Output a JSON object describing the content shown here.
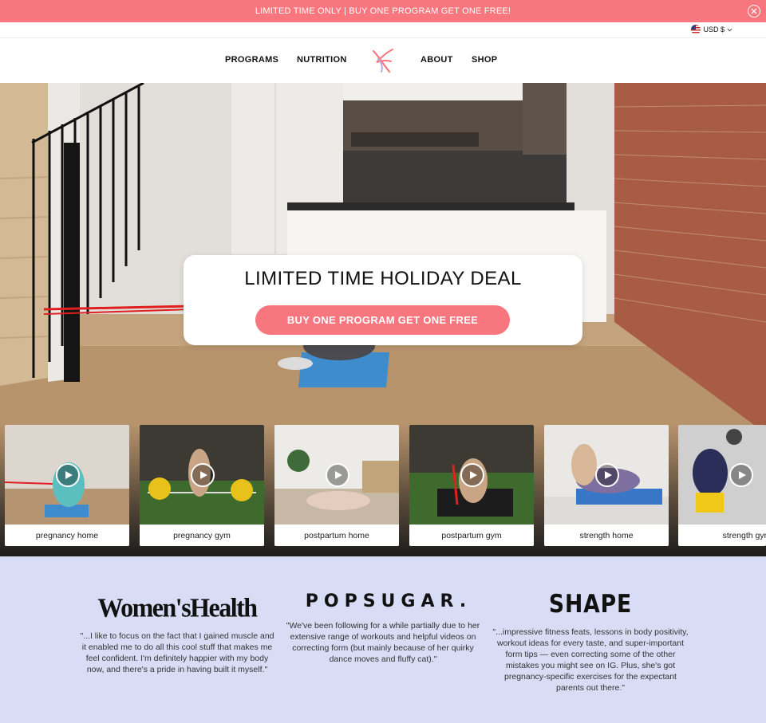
{
  "announcement": {
    "text": "LIMITED TIME ONLY | BUY ONE PROGRAM GET ONE FREE!",
    "close_icon": "close-circle-icon"
  },
  "currency": {
    "label": "USD $",
    "flag_icon": "us-flag-icon",
    "chevron_icon": "chevron-down-icon"
  },
  "nav": {
    "left": [
      "PROGRAMS",
      "NUTRITION"
    ],
    "right": [
      "ABOUT",
      "SHOP"
    ],
    "logo_icon": "brand-logo-icon"
  },
  "hero": {
    "title": "LIMITED TIME HOLIDAY DEAL",
    "button": "BUY ONE PROGRAM GET ONE FREE"
  },
  "programs": [
    {
      "label": "pregnancy home"
    },
    {
      "label": "pregnancy gym"
    },
    {
      "label": "postpartum home"
    },
    {
      "label": "postpartum gym"
    },
    {
      "label": "strength home"
    },
    {
      "label": "strength gym"
    }
  ],
  "press": [
    {
      "logo": "Women'sHealth",
      "quote": "\"...I like to focus on the fact that I gained muscle and it enabled me to do all this cool stuff that makes me feel confident. I'm definitely happier with my body now, and there's a pride in having built it myself.\""
    },
    {
      "logo": "POPSUGAR.",
      "quote": "\"We've been following for a while partially due to her extensive range of workouts and helpful videos on correcting form (but mainly because of her quirky dance moves and fluffy cat).\""
    },
    {
      "logo": "SHAPE",
      "quote": "\"...impressive fitness feats, lessons in body positivity, workout ideas for every taste, and super-important form tips — even correcting some of the other mistakes you might see on IG. Plus, she's got pregnancy-specific exercises for the expectant parents out there.\""
    }
  ],
  "colors": {
    "accent": "#f8767d",
    "press_bg": "#d9dcf5"
  }
}
